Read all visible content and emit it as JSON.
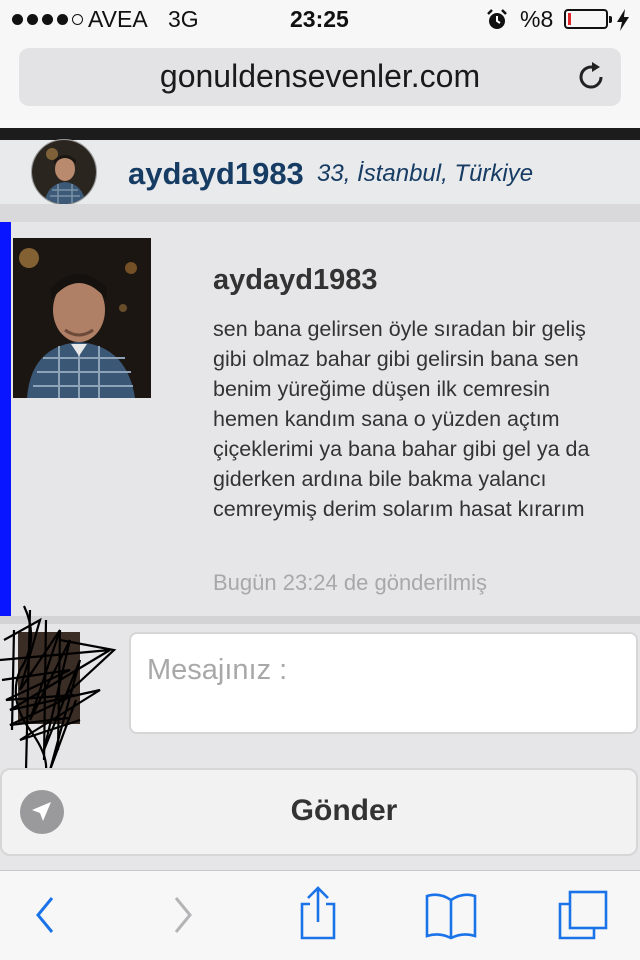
{
  "status_bar": {
    "carrier": "AVEA",
    "network": "3G",
    "time": "23:25",
    "battery_percent": "%8",
    "battery_level": 0.08,
    "icons": [
      "signal-dots-icon",
      "alarm-clock-icon",
      "battery-icon",
      "charging-bolt-icon"
    ],
    "battery_color": "#e0282b"
  },
  "browser": {
    "url": "gonuldensevenler.com",
    "icons": [
      "reload-icon",
      "back-icon",
      "forward-icon",
      "share-icon",
      "bookmarks-icon",
      "tabs-icon"
    ],
    "accent_color": "#1a73e8"
  },
  "profile": {
    "username": "aydayd1983",
    "meta": "33, İstanbul, Türkiye",
    "name_color": "#173c64"
  },
  "message": {
    "author": "aydayd1983",
    "body": "sen bana gelirsen öyle sıradan bir geliş gibi olmaz bahar gibi gelirsin bana sen benim yüreğime düşen ilk cemresin hemen kandım sana o yüzden açtım çiçeklerimi ya bana bahar gibi gel ya da giderken ardına bile bakma yalancı cemreymiş derim solarım hasat kırarım",
    "timestamp": "Bugün 23:24 de gönderilmiş",
    "unread_bar_color": "#0a15ff"
  },
  "compose": {
    "placeholder": "Mesajınız :",
    "value": "",
    "send_label": "Gönder",
    "icons": [
      "location-arrow-icon"
    ]
  }
}
